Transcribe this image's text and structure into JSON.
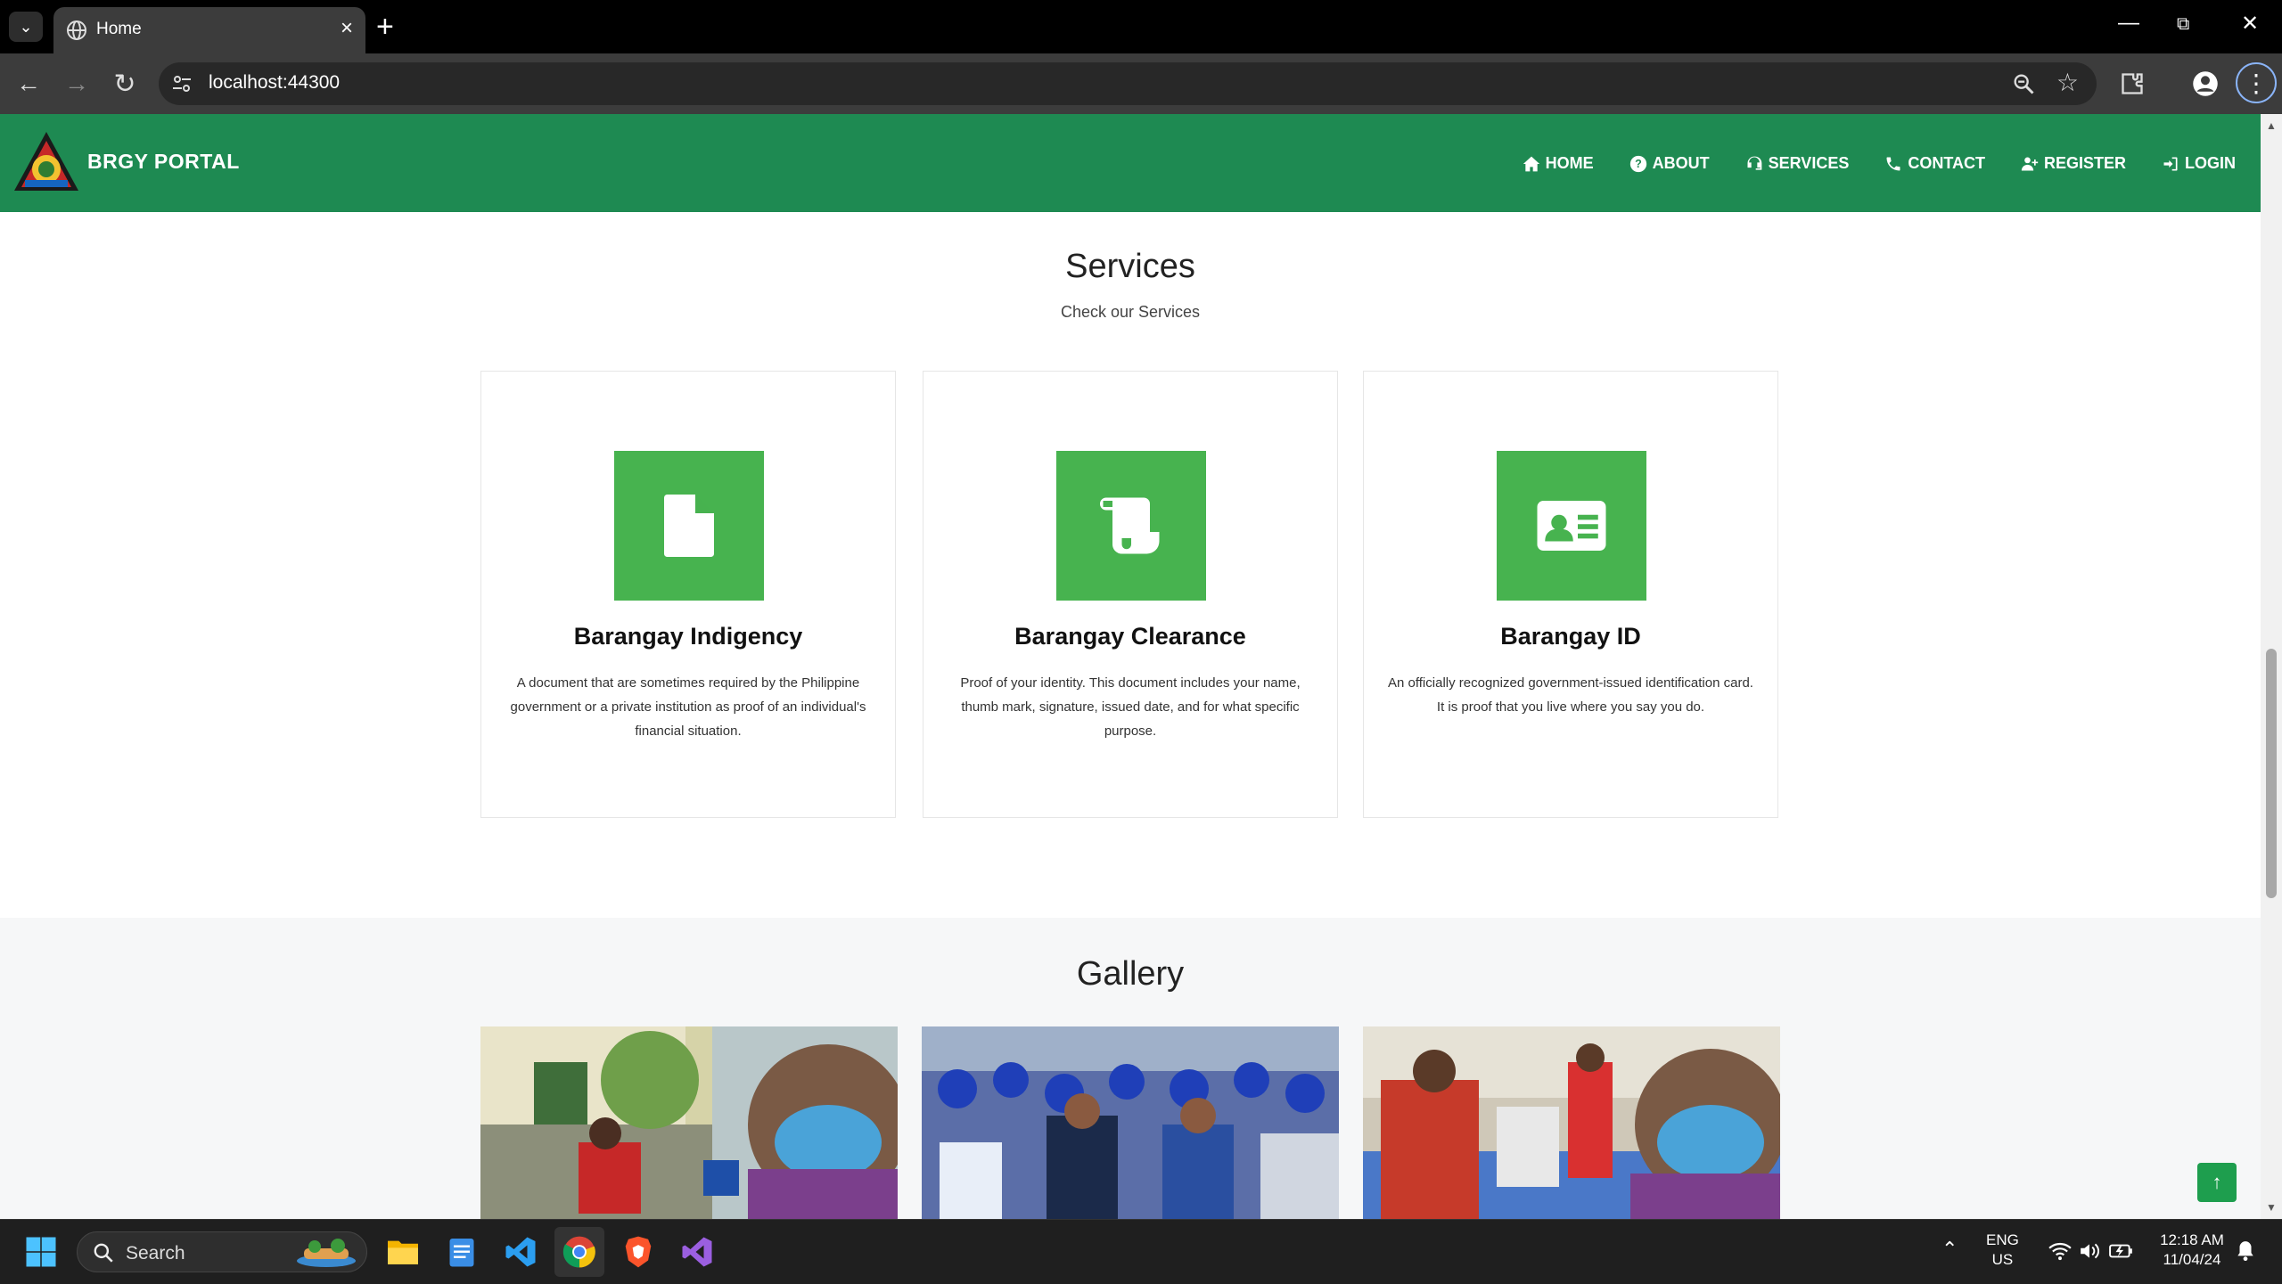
{
  "browser": {
    "tab_title": "Home",
    "url": "localhost:44300"
  },
  "site": {
    "brand": "BRGY PORTAL",
    "nav": [
      {
        "label": "HOME",
        "icon": "home-icon"
      },
      {
        "label": "ABOUT",
        "icon": "question-circle-icon"
      },
      {
        "label": "SERVICES",
        "icon": "headset-icon"
      },
      {
        "label": "CONTACT",
        "icon": "phone-icon"
      },
      {
        "label": "REGISTER",
        "icon": "user-plus-icon"
      },
      {
        "label": "LOGIN",
        "icon": "sign-in-icon"
      }
    ]
  },
  "services": {
    "title": "Services",
    "subtitle": "Check our Services",
    "cards": [
      {
        "icon": "file-icon",
        "title": "Barangay Indigency",
        "desc": "A document that are sometimes required by the Philippine government or a private institution as proof of an individual's financial situation."
      },
      {
        "icon": "scroll-icon",
        "title": "Barangay Clearance",
        "desc": "Proof of your identity. This document includes your name, thumb mark, signature, issued date, and for what specific purpose."
      },
      {
        "icon": "id-card-icon",
        "title": "Barangay ID",
        "desc": "An officially recognized government-issued identification card. It is proof that you live where you say you do."
      }
    ]
  },
  "gallery": {
    "title": "Gallery"
  },
  "colors": {
    "nav_green": "#1e8a52",
    "icon_green": "#47b34f"
  },
  "taskbar": {
    "search_label": "Search",
    "lang_line1": "ENG",
    "lang_line2": "US",
    "time": "12:18 AM",
    "date": "11/04/24"
  }
}
